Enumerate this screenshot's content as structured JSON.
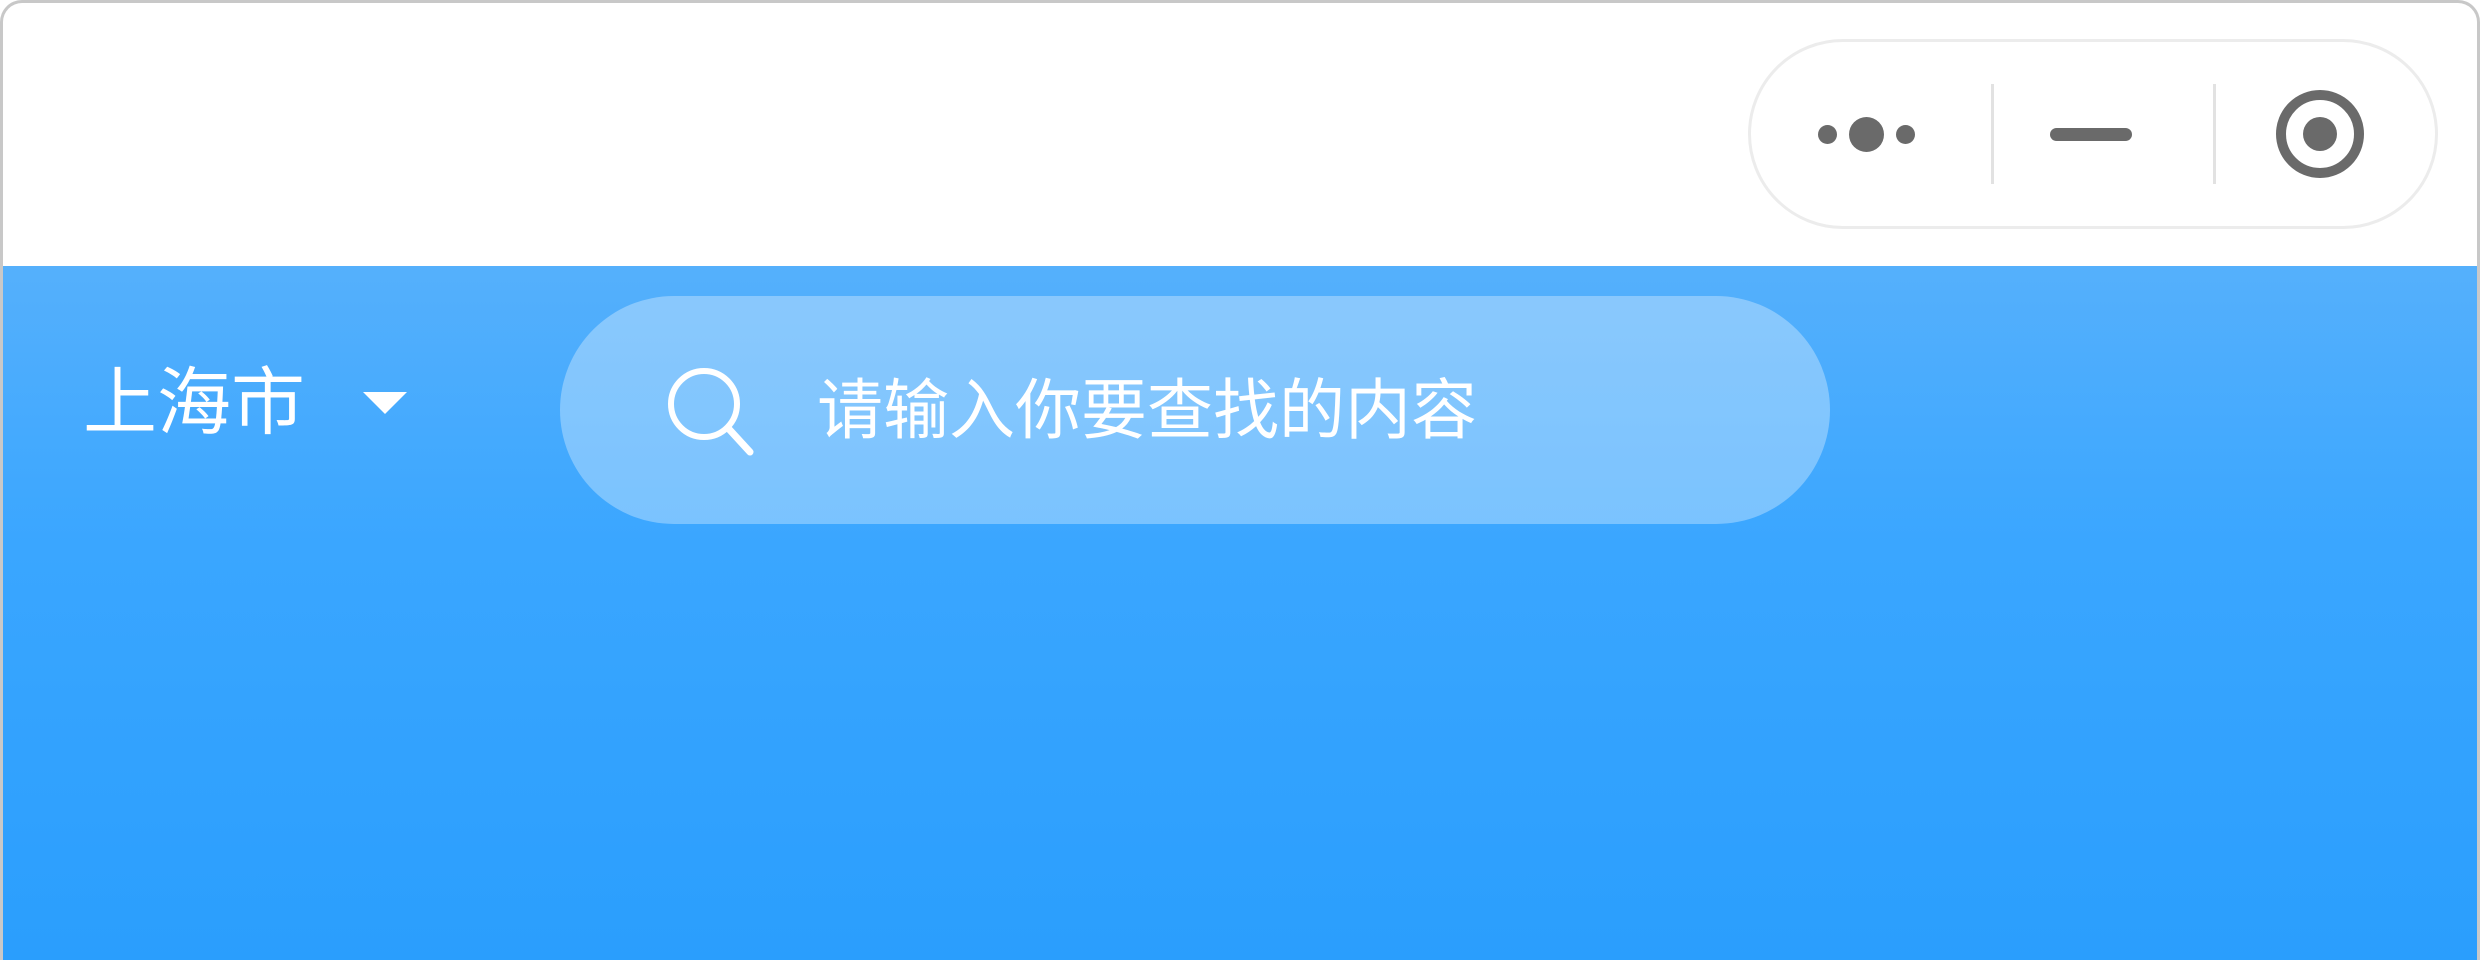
{
  "header": {
    "city": "上海市",
    "search": {
      "placeholder": "请输入你要查找的内容",
      "icon": "search-icon"
    }
  },
  "capsule": {
    "icons": [
      "more-icon",
      "minimize-icon",
      "close-target-icon"
    ]
  },
  "colors": {
    "header_blue": "#3aa6ff",
    "icon_gray": "#6a6a6a"
  }
}
